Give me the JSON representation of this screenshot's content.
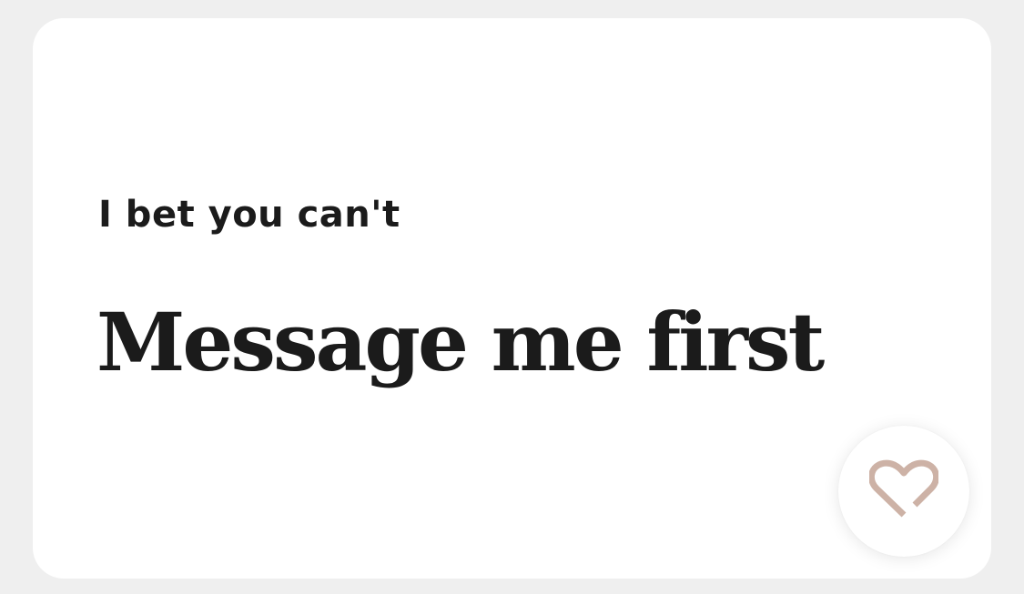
{
  "prompt": {
    "label": "I bet you can't",
    "answer": "Message me first"
  },
  "like_button": {
    "icon": "heart-icon",
    "icon_color": "#cdb2a6"
  },
  "colors": {
    "page_background": "#efefef",
    "card_background": "#ffffff",
    "text": "#1b1b1b"
  }
}
